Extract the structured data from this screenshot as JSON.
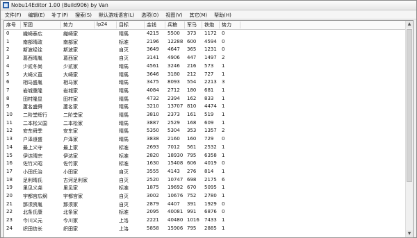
{
  "window": {
    "title": "Nobu14Editor 1.00 (Build906) by Van"
  },
  "menu": [
    {
      "label": "文件(F)"
    },
    {
      "label": "编辑(E)"
    },
    {
      "label": "补丁(P)"
    },
    {
      "label": "搜索(S)"
    },
    {
      "label": "默认游戏语言(L)"
    },
    {
      "label": "选项(O)"
    },
    {
      "label": "视图(V)"
    },
    {
      "label": "其它(M)"
    },
    {
      "label": "帮助(H)"
    }
  ],
  "table": {
    "columns": [
      "序号",
      "军团",
      "势力",
      "lp24",
      "目标",
      "金钱",
      "兵粮",
      "军马",
      "铁炮",
      "势力"
    ],
    "rows": [
      [
        "0",
        "織崎泰広",
        "織崎家",
        "",
        "晴馬",
        "4215",
        "5500",
        "373",
        "1172",
        "0"
      ],
      [
        "1",
        "南部晴政",
        "南部家",
        "",
        "标准",
        "2196",
        "12288",
        "600",
        "4594",
        "0"
      ],
      [
        "2",
        "斯波经诠",
        "斯波家",
        "",
        "自灭",
        "3649",
        "4647",
        "365",
        "1231",
        "0"
      ],
      [
        "3",
        "葛西晴胤",
        "葛西家",
        "",
        "自灭",
        "3141",
        "4906",
        "447",
        "1497",
        "2"
      ],
      [
        "4",
        "少贰冬尚",
        "少贰家",
        "",
        "晴馬",
        "4561",
        "3246",
        "216",
        "573",
        "1"
      ],
      [
        "5",
        "大崎义直",
        "大崎家",
        "",
        "晴馬",
        "3646",
        "3180",
        "212",
        "727",
        "1"
      ],
      [
        "6",
        "相马盛胤",
        "相马家",
        "",
        "晴馬",
        "3475",
        "8093",
        "554",
        "2213",
        "3"
      ],
      [
        "7",
        "岩城重隆",
        "岩城家",
        "",
        "晴馬",
        "4084",
        "2712",
        "180",
        "681",
        "1"
      ],
      [
        "8",
        "田村隆显",
        "田村家",
        "",
        "晴馬",
        "4732",
        "2394",
        "162",
        "833",
        "1"
      ],
      [
        "9",
        "蘆名盛舜",
        "蘆名家",
        "",
        "晴馬",
        "3210",
        "13707",
        "810",
        "4474",
        "1"
      ],
      [
        "10",
        "二阶堂辉行",
        "二阶堂家",
        "",
        "晴馬",
        "3810",
        "2373",
        "161",
        "519",
        "1"
      ],
      [
        "11",
        "二本松义国",
        "二本松家",
        "",
        "晴馬",
        "3887",
        "2529",
        "168",
        "609",
        "1"
      ],
      [
        "12",
        "安东舜季",
        "安东家",
        "",
        "晴馬",
        "5350",
        "5304",
        "353",
        "1357",
        "2"
      ],
      [
        "13",
        "户泽道盛",
        "户泽家",
        "",
        "晴馬",
        "3838",
        "2160",
        "160",
        "729",
        "0"
      ],
      [
        "14",
        "最上义守",
        "最上家",
        "",
        "标准",
        "2693",
        "7012",
        "561",
        "2532",
        "1"
      ],
      [
        "15",
        "伊达晴宗",
        "伊达家",
        "",
        "标准",
        "2820",
        "18930",
        "795",
        "6358",
        "1"
      ],
      [
        "16",
        "佐竹义昭",
        "佐竹家",
        "",
        "标准",
        "1630",
        "15408",
        "606",
        "4019",
        "0"
      ],
      [
        "17",
        "小田氏治",
        "小田家",
        "",
        "自灭",
        "3555",
        "4143",
        "276",
        "814",
        "1"
      ],
      [
        "18",
        "足利晴氏",
        "古河足利家",
        "",
        "自灭",
        "2520",
        "10747",
        "698",
        "2175",
        "6"
      ],
      [
        "19",
        "里见义尧",
        "里见家",
        "",
        "标准",
        "1875",
        "19692",
        "670",
        "5095",
        "1"
      ],
      [
        "20",
        "宇都宫広纲",
        "宇都宫家",
        "",
        "自灭",
        "3002",
        "10676",
        "752",
        "2780",
        "1"
      ],
      [
        "21",
        "那须资胤",
        "那须家",
        "",
        "自灭",
        "2879",
        "4407",
        "391",
        "1929",
        "0"
      ],
      [
        "22",
        "北条氏康",
        "北条家",
        "",
        "标准",
        "2095",
        "40081",
        "991",
        "6876",
        "0"
      ],
      [
        "23",
        "今川义元",
        "今川家",
        "",
        "上洛",
        "2221",
        "40480",
        "1016",
        "7433",
        "1"
      ],
      [
        "24",
        "织田信长",
        "织田家",
        "",
        "上洛",
        "5858",
        "15906",
        "795",
        "2885",
        "1"
      ]
    ]
  }
}
